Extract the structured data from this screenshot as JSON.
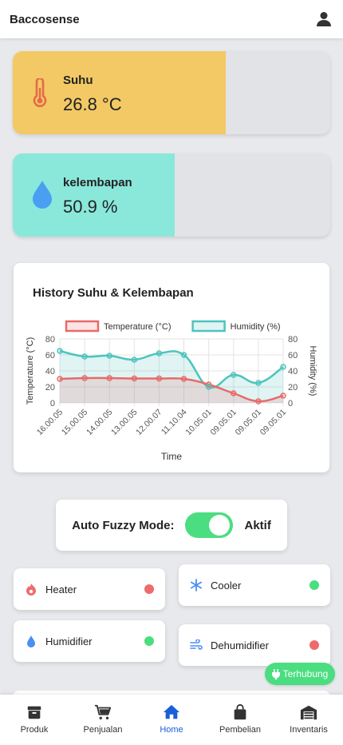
{
  "app": {
    "title": "Baccosense"
  },
  "temperature": {
    "label": "Suhu",
    "value": "26.8 °C",
    "level": 0.67,
    "color": "#f2c964"
  },
  "humidity": {
    "label": "kelembapan",
    "value": "50.9 %",
    "level": 0.509,
    "color": "#8ae8da"
  },
  "chart_card": {
    "title": "History Suhu & Kelembapan"
  },
  "chart_data": {
    "type": "line",
    "title": "History Suhu & Kelembapan",
    "xlabel": "Time",
    "ylabel_left": "Temperature (°C)",
    "ylabel_right": "Humidity (%)",
    "ylim_left": [
      0,
      80
    ],
    "ylim_right": [
      0,
      80
    ],
    "yticks": [
      0,
      20,
      40,
      60,
      80
    ],
    "grid": true,
    "legend_position": "top",
    "categories": [
      "16.00.05",
      "15.00.05",
      "14.00.05",
      "13.00.05",
      "12.00.07",
      "11.10.04",
      "10.05.01",
      "09.05.01",
      "09.05.01",
      "09.05.01"
    ],
    "series": [
      {
        "name": "Temperature (°C)",
        "axis": "left",
        "color": "#e86a6a",
        "fill": "rgba(232,106,106,0.18)",
        "values": [
          30,
          31,
          31,
          30.5,
          30.5,
          30,
          23,
          12,
          2,
          9
        ]
      },
      {
        "name": "Humidity (%)",
        "axis": "right",
        "color": "#4ec4bd",
        "fill": "rgba(78,196,189,0.18)",
        "values": [
          65,
          58,
          59,
          54,
          62,
          60,
          20,
          35,
          25,
          45
        ]
      }
    ]
  },
  "fuzzy": {
    "label": "Auto Fuzzy Mode:",
    "state": "Aktif",
    "enabled": true
  },
  "devices": [
    {
      "name": "Heater",
      "icon": "flame-icon",
      "status_color": "#ee6b6b"
    },
    {
      "name": "Cooler",
      "icon": "snowflake-icon",
      "status_color": "#4ade80"
    },
    {
      "name": "Humidifier",
      "icon": "droplet-icon",
      "status_color": "#4ade80"
    },
    {
      "name": "Dehumidifier",
      "icon": "wind-icon",
      "status_color": "#ee6b6b"
    }
  ],
  "connection": {
    "label": "Terhubung",
    "color": "#4ade80"
  },
  "nav": [
    {
      "label": "Produk",
      "icon": "box-icon"
    },
    {
      "label": "Penjualan",
      "icon": "cart-icon"
    },
    {
      "label": "Home",
      "icon": "home-icon",
      "active": true
    },
    {
      "label": "Pembelian",
      "icon": "bag-icon"
    },
    {
      "label": "Inventaris",
      "icon": "warehouse-icon"
    }
  ]
}
